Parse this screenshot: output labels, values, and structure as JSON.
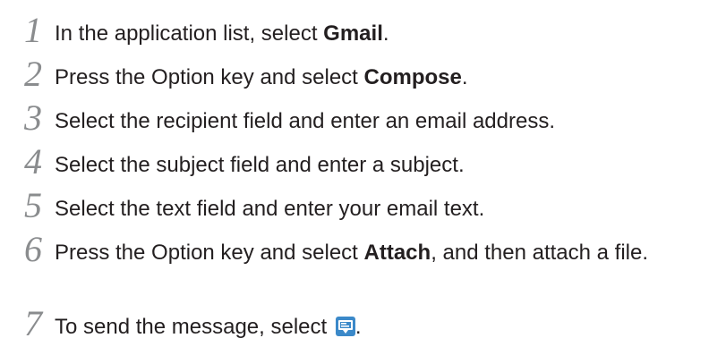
{
  "steps": [
    {
      "number": "1",
      "before": "In the application list, select ",
      "bold": "Gmail",
      "after": "."
    },
    {
      "number": "2",
      "before": "Press the Option key and select ",
      "bold": "Compose",
      "after": "."
    },
    {
      "number": "3",
      "text": "Select the recipient field and enter an email address."
    },
    {
      "number": "4",
      "text": "Select the subject field and enter a subject."
    },
    {
      "number": "5",
      "text": "Select the text field and enter your email text."
    },
    {
      "number": "6",
      "before": "Press the Option key and select ",
      "bold": "Attach",
      "after": ", and then attach a file."
    },
    {
      "number": "7",
      "before": "To send the message, select ",
      "icon": "send-message-icon",
      "after": "."
    }
  ],
  "colors": {
    "step_number": "#8a8c8e",
    "body_text": "#231f20",
    "icon_blue": "#3b89c9"
  }
}
